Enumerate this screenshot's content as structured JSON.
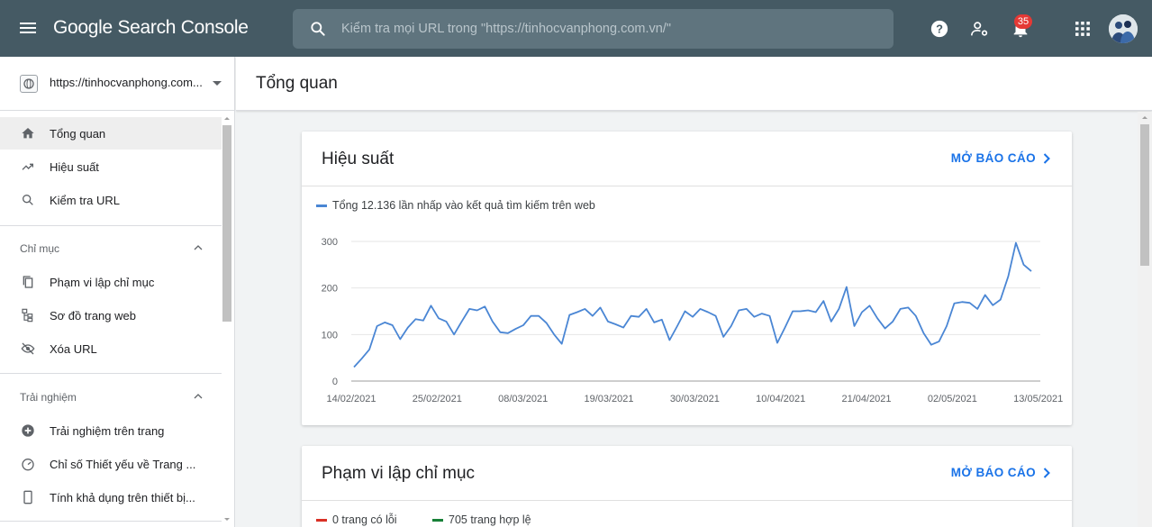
{
  "topbar": {
    "brand": "Google Search Console",
    "search_placeholder": "Kiểm tra mọi URL trong \"https://tinhocvanphong.com.vn/\"",
    "notification_count": "35"
  },
  "sidebar": {
    "property_url": "https://tinhocvanphong.com....",
    "items": [
      {
        "label": "Tổng quan",
        "icon": "home-icon"
      },
      {
        "label": "Hiệu suất",
        "icon": "trending-up-icon"
      },
      {
        "label": "Kiểm tra URL",
        "icon": "search-icon"
      }
    ],
    "sections": [
      {
        "label": "Chỉ mục",
        "items": [
          {
            "label": "Phạm vi lập chỉ mục",
            "icon": "file-copy-icon"
          },
          {
            "label": "Sơ đồ trang web",
            "icon": "sitemap-icon"
          },
          {
            "label": "Xóa URL",
            "icon": "eye-off-icon"
          }
        ]
      },
      {
        "label": "Trải nghiệm",
        "items": [
          {
            "label": "Trải nghiệm trên trang",
            "icon": "plus-circle-icon"
          },
          {
            "label": "Chỉ số Thiết yếu về Trang ...",
            "icon": "speed-icon"
          },
          {
            "label": "Tính khả dụng trên thiết bị...",
            "icon": "phone-icon"
          }
        ]
      }
    ]
  },
  "main": {
    "page_title": "Tổng quan",
    "performance_card": {
      "title": "Hiệu suất",
      "open_report": "MỞ BÁO CÁO",
      "legend": "Tổng 12.136 lần nhấp vào kết quả tìm kiếm trên web"
    },
    "coverage_card": {
      "title": "Phạm vi lập chỉ mục",
      "open_report": "MỞ BÁO CÁO",
      "legend_errors": "0 trang có lỗi",
      "legend_valid": "705 trang hợp lệ"
    }
  },
  "colors": {
    "topbar": "#455a64",
    "line": "#4a86d4",
    "link": "#1a73e8",
    "error": "#d93025",
    "valid": "#188038"
  },
  "chart_data": {
    "type": "line",
    "series_name": "",
    "ylim": [
      0,
      300
    ],
    "yticks": [
      "0",
      "100",
      "200",
      "300"
    ],
    "xticks": [
      "14/02/2021",
      "25/02/2021",
      "08/03/2021",
      "19/03/2021",
      "30/03/2021",
      "10/04/2021",
      "21/04/2021",
      "02/05/2021",
      "13/05/2021"
    ],
    "x_start": "14/02/2021",
    "x_end": "14/05/2021",
    "values": [
      30,
      48,
      68,
      118,
      126,
      120,
      90,
      115,
      133,
      130,
      162,
      135,
      128,
      100,
      128,
      155,
      152,
      160,
      128,
      105,
      103,
      112,
      120,
      140,
      140,
      125,
      100,
      80,
      142,
      148,
      155,
      140,
      158,
      128,
      122,
      115,
      140,
      138,
      155,
      126,
      132,
      88,
      118,
      150,
      138,
      155,
      148,
      140,
      95,
      118,
      152,
      155,
      138,
      145,
      140,
      82,
      115,
      150,
      150,
      152,
      148,
      172,
      128,
      155,
      202,
      118,
      148,
      162,
      135,
      113,
      128,
      155,
      158,
      140,
      103,
      78,
      85,
      118,
      167,
      170,
      168,
      155,
      185,
      163,
      175,
      225,
      297,
      250,
      236
    ]
  }
}
